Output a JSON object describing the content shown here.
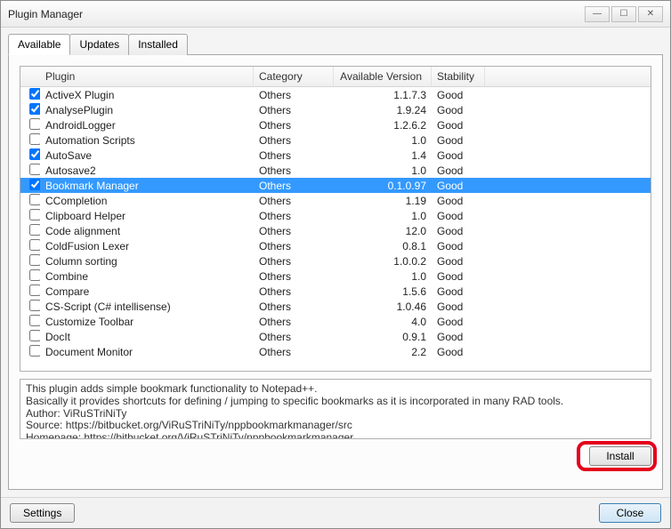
{
  "window": {
    "title": "Plugin Manager"
  },
  "tabs": [
    {
      "label": "Available",
      "active": true
    },
    {
      "label": "Updates",
      "active": false
    },
    {
      "label": "Installed",
      "active": false
    }
  ],
  "columns": {
    "plugin": "Plugin",
    "category": "Category",
    "version": "Available Version",
    "stability": "Stability"
  },
  "plugins": [
    {
      "name": "ActiveX Plugin",
      "category": "Others",
      "version": "1.1.7.3",
      "stability": "Good",
      "checked": true,
      "selected": false
    },
    {
      "name": "AnalysePlugin",
      "category": "Others",
      "version": "1.9.24",
      "stability": "Good",
      "checked": true,
      "selected": false
    },
    {
      "name": "AndroidLogger",
      "category": "Others",
      "version": "1.2.6.2",
      "stability": "Good",
      "checked": false,
      "selected": false
    },
    {
      "name": "Automation Scripts",
      "category": "Others",
      "version": "1.0",
      "stability": "Good",
      "checked": false,
      "selected": false
    },
    {
      "name": "AutoSave",
      "category": "Others",
      "version": "1.4",
      "stability": "Good",
      "checked": true,
      "selected": false
    },
    {
      "name": "Autosave2",
      "category": "Others",
      "version": "1.0",
      "stability": "Good",
      "checked": false,
      "selected": false
    },
    {
      "name": "Bookmark Manager",
      "category": "Others",
      "version": "0.1.0.97",
      "stability": "Good",
      "checked": true,
      "selected": true
    },
    {
      "name": "CCompletion",
      "category": "Others",
      "version": "1.19",
      "stability": "Good",
      "checked": false,
      "selected": false
    },
    {
      "name": "Clipboard Helper",
      "category": "Others",
      "version": "1.0",
      "stability": "Good",
      "checked": false,
      "selected": false
    },
    {
      "name": "Code alignment",
      "category": "Others",
      "version": "12.0",
      "stability": "Good",
      "checked": false,
      "selected": false
    },
    {
      "name": "ColdFusion Lexer",
      "category": "Others",
      "version": "0.8.1",
      "stability": "Good",
      "checked": false,
      "selected": false
    },
    {
      "name": "Column sorting",
      "category": "Others",
      "version": "1.0.0.2",
      "stability": "Good",
      "checked": false,
      "selected": false
    },
    {
      "name": "Combine",
      "category": "Others",
      "version": "1.0",
      "stability": "Good",
      "checked": false,
      "selected": false
    },
    {
      "name": "Compare",
      "category": "Others",
      "version": "1.5.6",
      "stability": "Good",
      "checked": false,
      "selected": false
    },
    {
      "name": "CS-Script (C# intellisense)",
      "category": "Others",
      "version": "1.0.46",
      "stability": "Good",
      "checked": false,
      "selected": false
    },
    {
      "name": "Customize Toolbar",
      "category": "Others",
      "version": "4.0",
      "stability": "Good",
      "checked": false,
      "selected": false
    },
    {
      "name": "DocIt",
      "category": "Others",
      "version": "0.9.1",
      "stability": "Good",
      "checked": false,
      "selected": false
    },
    {
      "name": "Document Monitor",
      "category": "Others",
      "version": "2.2",
      "stability": "Good",
      "checked": false,
      "selected": false
    }
  ],
  "description": {
    "line1": "This plugin adds simple bookmark functionality to Notepad++.",
    "line2": "Basically it provides shortcuts for defining / jumping to specific bookmarks as it is incorporated in many RAD tools.",
    "line3": "Author: ViRuSTriNiTy",
    "line4": "Source: https://bitbucket.org/ViRuSTriNiTy/nppbookmarkmanager/src",
    "line5": "Homepage: https://bitbucket.org/ViRuSTriNiTy/nppbookmarkmanager"
  },
  "buttons": {
    "install": "Install",
    "settings": "Settings",
    "close": "Close"
  }
}
